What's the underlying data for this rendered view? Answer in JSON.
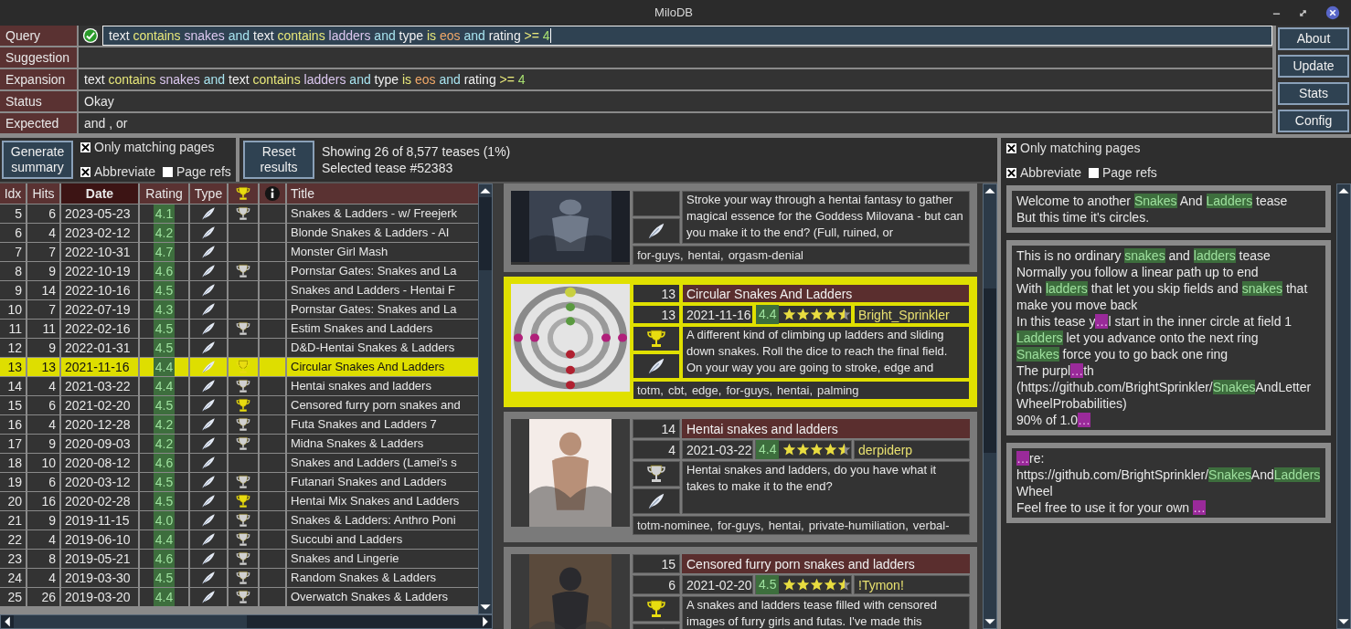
{
  "window": {
    "title": "MiloDB"
  },
  "query_panel": {
    "fields": [
      {
        "label": "Query",
        "kind": "query",
        "valid": true,
        "tokens": [
          {
            "text": "text",
            "kind": "field"
          },
          {
            "text": "contains",
            "kind": "op"
          },
          {
            "text": "snakes",
            "kind": "value"
          },
          {
            "text": "and",
            "kind": "logic"
          },
          {
            "text": "text",
            "kind": "field"
          },
          {
            "text": "contains",
            "kind": "op"
          },
          {
            "text": "ladders",
            "kind": "value"
          },
          {
            "text": "and",
            "kind": "logic"
          },
          {
            "text": "type",
            "kind": "field"
          },
          {
            "text": "is",
            "kind": "op"
          },
          {
            "text": "eos",
            "kind": "enum"
          },
          {
            "text": "and",
            "kind": "logic"
          },
          {
            "text": "rating",
            "kind": "field"
          },
          {
            "text": ">=",
            "kind": "op"
          },
          {
            "text": "4",
            "kind": "num"
          }
        ]
      },
      {
        "label": "Suggestion",
        "kind": "plain"
      },
      {
        "label": "Expansion",
        "kind": "tokens",
        "tokens": [
          {
            "text": "text",
            "kind": "field"
          },
          {
            "text": "contains",
            "kind": "op"
          },
          {
            "text": "snakes",
            "kind": "value"
          },
          {
            "text": "and",
            "kind": "logic"
          },
          {
            "text": "text",
            "kind": "field"
          },
          {
            "text": "contains",
            "kind": "op"
          },
          {
            "text": "ladders",
            "kind": "value"
          },
          {
            "text": "and",
            "kind": "logic"
          },
          {
            "text": "type",
            "kind": "field"
          },
          {
            "text": "is",
            "kind": "op"
          },
          {
            "text": "eos",
            "kind": "enum"
          },
          {
            "text": "and",
            "kind": "logic"
          },
          {
            "text": "rating",
            "kind": "field"
          },
          {
            "text": ">=",
            "kind": "op"
          },
          {
            "text": "4",
            "kind": "num"
          }
        ]
      },
      {
        "label": "Status",
        "kind": "plain",
        "value": "Okay"
      },
      {
        "label": "Expected",
        "kind": "plain",
        "value": "and , or"
      }
    ],
    "buttons": [
      "About",
      "Update",
      "Stats",
      "Config"
    ]
  },
  "toolbar": {
    "summary_button": "Generate summary",
    "options": [
      {
        "label": "Only matching pages",
        "checked": true
      },
      {
        "label": "Abbreviate",
        "checked": true
      },
      {
        "label": "Page refs",
        "checked": false
      }
    ],
    "reset_button": "Reset results",
    "status": [
      "Showing 26 of 8,577 teases (1%)",
      "Selected tease #52383"
    ]
  },
  "table": {
    "columns": [
      {
        "label": "Idx",
        "kind": "text",
        "sorted": false
      },
      {
        "label": "Hits",
        "kind": "text",
        "sorted": false
      },
      {
        "label": "Date",
        "kind": "text",
        "sorted": true
      },
      {
        "label": "Rating",
        "kind": "text",
        "sorted": false
      },
      {
        "label": "Type",
        "kind": "text",
        "sorted": false
      },
      {
        "kind": "trophy",
        "sorted": false
      },
      {
        "kind": "info",
        "sorted": false
      },
      {
        "label": "Title",
        "kind": "text",
        "sorted": false
      }
    ],
    "rows": [
      {
        "idx": "5",
        "hits": "6",
        "date": "2023-05-23",
        "rating": "4.1",
        "totm": false,
        "nominee": true,
        "title": "Snakes & Ladders - w/ Freejerk",
        "selected": false
      },
      {
        "idx": "6",
        "hits": "4",
        "date": "2023-02-12",
        "rating": "4.2",
        "totm": false,
        "nominee": false,
        "title": "Blonde Snakes & Ladders - AI",
        "selected": false
      },
      {
        "idx": "7",
        "hits": "7",
        "date": "2022-10-31",
        "rating": "4.7",
        "totm": false,
        "nominee": false,
        "title": "Monster Girl Mash",
        "selected": false
      },
      {
        "idx": "8",
        "hits": "9",
        "date": "2022-10-19",
        "rating": "4.6",
        "totm": false,
        "nominee": true,
        "title": "Pornstar Gates: Snakes and La",
        "selected": false
      },
      {
        "idx": "9",
        "hits": "14",
        "date": "2022-10-16",
        "rating": "4.5",
        "totm": false,
        "nominee": false,
        "title": "Snakes and Ladders - Hentai F",
        "selected": false
      },
      {
        "idx": "10",
        "hits": "7",
        "date": "2022-07-19",
        "rating": "4.3",
        "totm": false,
        "nominee": false,
        "title": "Pornstar Gates: Snakes and La",
        "selected": false
      },
      {
        "idx": "11",
        "hits": "11",
        "date": "2022-02-16",
        "rating": "4.5",
        "totm": false,
        "nominee": true,
        "title": "Estim Snakes and Ladders",
        "selected": false
      },
      {
        "idx": "12",
        "hits": "9",
        "date": "2022-01-31",
        "rating": "4.5",
        "totm": false,
        "nominee": false,
        "title": "D&D-Hentai Snakes & Ladders",
        "selected": false
      },
      {
        "idx": "13",
        "hits": "13",
        "date": "2021-11-16",
        "rating": "4.4",
        "totm": true,
        "nominee": false,
        "title": "Circular Snakes And Ladders",
        "selected": true
      },
      {
        "idx": "14",
        "hits": "4",
        "date": "2021-03-22",
        "rating": "4.4",
        "totm": false,
        "nominee": true,
        "title": "Hentai snakes and ladders",
        "selected": false
      },
      {
        "idx": "15",
        "hits": "6",
        "date": "2021-02-20",
        "rating": "4.5",
        "totm": true,
        "nominee": false,
        "title": "Censored furry porn snakes and",
        "selected": false
      },
      {
        "idx": "16",
        "hits": "4",
        "date": "2020-12-28",
        "rating": "4.2",
        "totm": false,
        "nominee": true,
        "title": "Futa Snakes and Ladders 7",
        "selected": false
      },
      {
        "idx": "17",
        "hits": "9",
        "date": "2020-09-03",
        "rating": "4.2",
        "totm": false,
        "nominee": true,
        "title": "Midna Snakes & Ladders",
        "selected": false
      },
      {
        "idx": "18",
        "hits": "10",
        "date": "2020-08-12",
        "rating": "4.6",
        "totm": false,
        "nominee": false,
        "title": "Snakes and Ladders (Lamei's s",
        "selected": false
      },
      {
        "idx": "19",
        "hits": "6",
        "date": "2020-03-12",
        "rating": "4.5",
        "totm": false,
        "nominee": true,
        "title": "Futanari Snakes and Ladders",
        "selected": false
      },
      {
        "idx": "20",
        "hits": "16",
        "date": "2020-02-28",
        "rating": "4.5",
        "totm": true,
        "nominee": false,
        "title": "Hentai Mix Snakes and Ladders",
        "selected": false
      },
      {
        "idx": "21",
        "hits": "9",
        "date": "2019-11-15",
        "rating": "4.0",
        "totm": false,
        "nominee": true,
        "title": "Snakes & Ladders: Anthro Poni",
        "selected": false
      },
      {
        "idx": "22",
        "hits": "4",
        "date": "2019-06-10",
        "rating": "4.4",
        "totm": false,
        "nominee": true,
        "title": "Succubi and Ladders",
        "selected": false
      },
      {
        "idx": "23",
        "hits": "8",
        "date": "2019-05-21",
        "rating": "4.6",
        "totm": false,
        "nominee": true,
        "title": "Snakes and Lingerie",
        "selected": false
      },
      {
        "idx": "24",
        "hits": "4",
        "date": "2019-03-30",
        "rating": "4.5",
        "totm": false,
        "nominee": true,
        "title": "Random Snakes & Ladders",
        "selected": false
      },
      {
        "idx": "25",
        "hits": "26",
        "date": "2019-03-20",
        "rating": "4.4",
        "totm": false,
        "nominee": true,
        "title": "Overwatch Snakes & Ladders",
        "selected": false
      }
    ]
  },
  "cards": [
    {
      "totm": false,
      "nominee": false,
      "description": "Stroke your way through a hentai fantasy to gather magical essence for the Goddess Milovana - but can you make it to the end? (Full, ruined, or",
      "tags": [
        "for-guys,",
        "hentai,",
        "orgasm-denial"
      ],
      "selected": false
    },
    {
      "idx": "13",
      "title": "Circular Snakes And Ladders",
      "hits": "13",
      "date": "2021-11-16",
      "rating": "4.4",
      "stars": 4.5,
      "author": "Bright_Sprinkler",
      "totm": true,
      "nominee": false,
      "description": "A different kind of climbing up ladders and sliding down snakes. Roll the dice to reach the final field. On your way you are going to stroke, edge and",
      "tags": [
        "totm,",
        "cbt,",
        "edge,",
        "for-guys,",
        "hentai,",
        "palming"
      ],
      "selected": true
    },
    {
      "idx": "14",
      "title": "Hentai snakes and ladders",
      "hits": "4",
      "date": "2021-03-22",
      "rating": "4.4",
      "stars": 4.5,
      "author": "derpiderp",
      "totm": false,
      "nominee": true,
      "description": "Hentai snakes and ladders, do you have what it takes to make it to the end?",
      "tags": [
        "totm-nominee,",
        "for-guys,",
        "hentai,",
        "private-humiliation,",
        "verbal-"
      ],
      "selected": false
    },
    {
      "idx": "15",
      "title": "Censored furry porn snakes and ladders",
      "hits": "6",
      "date": "2021-02-20",
      "rating": "4.5",
      "stars": 4.5,
      "author": "!Tymon!",
      "totm": true,
      "nominee": false,
      "description": "A snakes and ladders tease filled with censored images of furry girls and futas. I've made this",
      "selected": false
    }
  ],
  "preview": {
    "options": [
      {
        "label": "Only matching pages",
        "checked": true
      },
      {
        "label": "Abbreviate",
        "checked": true
      },
      {
        "label": "Page refs",
        "checked": false
      }
    ],
    "blocks": [
      [
        {
          "text": "Welcome to another ",
          "kind": "plain"
        },
        {
          "text": "Snakes",
          "kind": "match"
        },
        {
          "text": " And ",
          "kind": "plain"
        },
        {
          "text": "Ladders",
          "kind": "match"
        },
        {
          "text": " tease\nBut this time it's circles.",
          "kind": "plain"
        }
      ],
      [
        {
          "text": "This is no ordinary ",
          "kind": "plain"
        },
        {
          "text": "snakes",
          "kind": "match"
        },
        {
          "text": " and ",
          "kind": "plain"
        },
        {
          "text": "ladders",
          "kind": "match"
        },
        {
          "text": " tease\nNormally you follow a linear path up to end\nWith ",
          "kind": "plain"
        },
        {
          "text": "ladders",
          "kind": "match"
        },
        {
          "text": " that let you skip fields and ",
          "kind": "plain"
        },
        {
          "text": "snakes",
          "kind": "match"
        },
        {
          "text": " that make you move back\nIn this tease y",
          "kind": "plain"
        },
        {
          "text": "…",
          "kind": "ellipsis"
        },
        {
          "text": "l start in the inner circle at field 1\n",
          "kind": "plain"
        },
        {
          "text": "Ladders",
          "kind": "match"
        },
        {
          "text": " let you advance onto the next ring\n",
          "kind": "plain"
        },
        {
          "text": "Snakes",
          "kind": "match"
        },
        {
          "text": " force you to go back one ring\nThe purpl",
          "kind": "plain"
        },
        {
          "text": "…",
          "kind": "ellipsis"
        },
        {
          "text": "th\n(https://github.com/BrightSprinkler/",
          "kind": "plain"
        },
        {
          "text": "Snakes",
          "kind": "match"
        },
        {
          "text": "AndLetterWheelProbabilities)\n90% of 1.0",
          "kind": "plain"
        },
        {
          "text": "…",
          "kind": "ellipsis"
        }
      ],
      [
        {
          "text": "…",
          "kind": "ellipsis"
        },
        {
          "text": "re:\nhttps://github.com/BrightSprinkler/",
          "kind": "plain"
        },
        {
          "text": "Snakes",
          "kind": "match"
        },
        {
          "text": "And",
          "kind": "plain"
        },
        {
          "text": "Ladders",
          "kind": "match"
        },
        {
          "text": "Wheel\nFeel free to use it for your own ",
          "kind": "plain"
        },
        {
          "text": "…",
          "kind": "ellipsis"
        }
      ]
    ]
  }
}
